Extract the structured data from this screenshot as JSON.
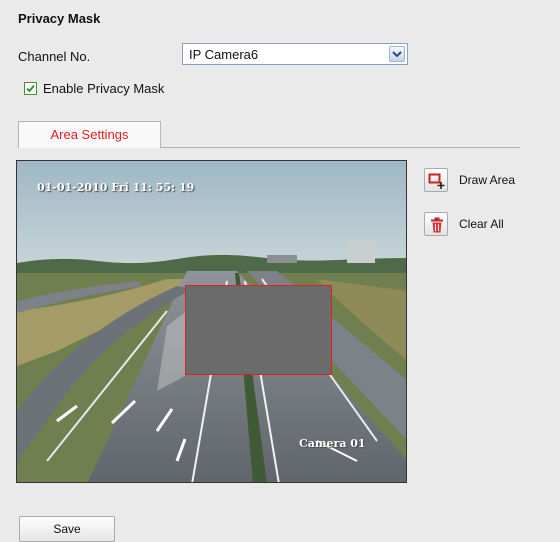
{
  "section": {
    "title": "Privacy Mask"
  },
  "channel": {
    "label": "Channel No.",
    "selected": "IP Camera6"
  },
  "enable": {
    "label": "Enable Privacy Mask",
    "checked": true
  },
  "tabs": [
    {
      "label": "Area Settings",
      "active": true
    }
  ],
  "video": {
    "timestamp": "01-01-2010  Fri  11: 55: 19",
    "camera_label": "Camera 01"
  },
  "tools": {
    "draw_area": {
      "label": "Draw Area",
      "icon": "draw-area-icon"
    },
    "clear_all": {
      "label": "Clear All",
      "icon": "trash-icon"
    }
  },
  "footer": {
    "save_label": "Save"
  },
  "colors": {
    "accent": "#e02020",
    "mask": "#6b6b6b",
    "mask_border": "#dd2222"
  }
}
